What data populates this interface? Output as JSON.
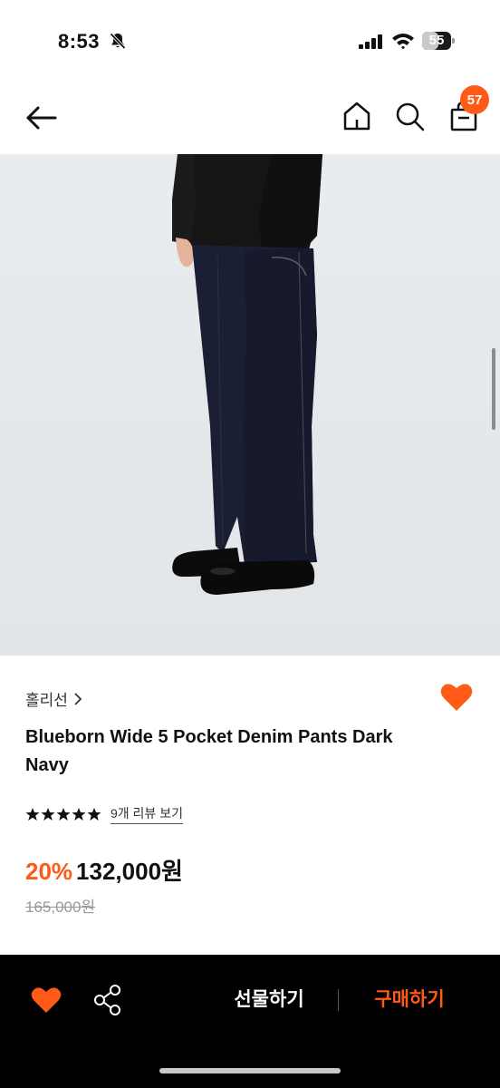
{
  "status_bar": {
    "time": "8:53",
    "battery": "55",
    "battery_level": 0.55,
    "icons": [
      "bell-slash-icon",
      "signal-icon",
      "wifi-icon",
      "battery-icon"
    ]
  },
  "nav": {
    "icons": [
      "back-arrow-icon",
      "home-icon",
      "search-icon",
      "shopping-bag-icon"
    ],
    "cart_count": "57"
  },
  "product": {
    "brand": "홀리선",
    "title": "Blueborn Wide 5 Pocket Denim Pants Dark Navy",
    "rating_stars": 5,
    "review_link": "9개 리뷰 보기",
    "discount": "20%",
    "price": "132,000원",
    "original_price": "165,000원",
    "wishlisted": true
  },
  "bottom_bar": {
    "gift_label": "선물하기",
    "buy_label": "구매하기",
    "icons": [
      "heart-icon",
      "share-icon"
    ]
  },
  "colors": {
    "accent": "#ff5a16",
    "image_background": "#e7eaed",
    "bottom_bar": "#000000"
  }
}
